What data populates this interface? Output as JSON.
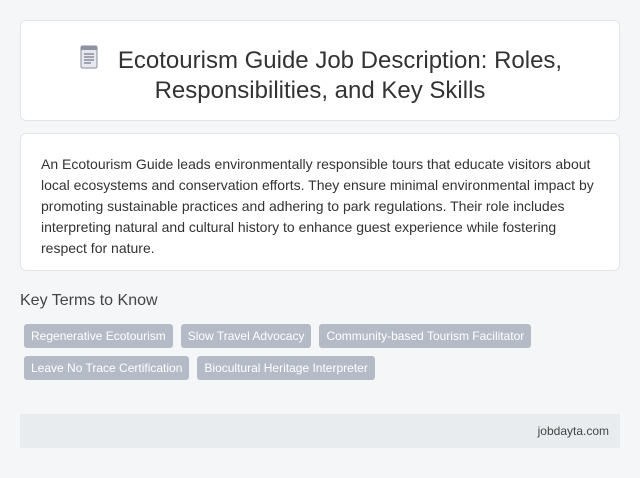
{
  "header": {
    "icon": "document-icon",
    "title": "Ecotourism Guide Job Description: Roles, Responsibilities, and Key Skills"
  },
  "description": {
    "text": "An Ecotourism Guide leads environmentally responsible tours that educate visitors about local ecosystems and conservation efforts. They ensure minimal environmental impact by promoting sustainable practices and adhering to park regulations. Their role includes interpreting natural and cultural history to enhance guest experience while fostering respect for nature."
  },
  "key_terms": {
    "heading": "Key Terms to Know",
    "tags": [
      "Regenerative Ecotourism",
      "Slow Travel Advocacy",
      "Community-based Tourism Facilitator",
      "Leave No Trace Certification",
      "Biocultural Heritage Interpreter"
    ]
  },
  "footer": {
    "site": "jobdayta.com"
  },
  "colors": {
    "tag_bg": "#b5bac7",
    "footer_bg": "#e8ecee",
    "page_bg": "#f5f6f7"
  }
}
